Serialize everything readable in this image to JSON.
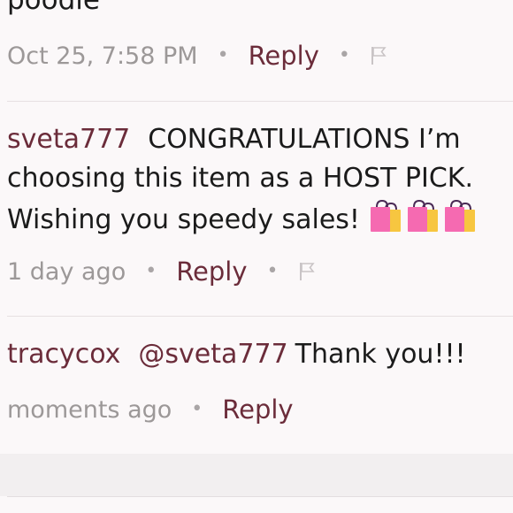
{
  "previous_comment": {
    "text_tail": "poodle",
    "timestamp": "Oct 25, 7:58 PM",
    "reply_label": "Reply",
    "separator": "•"
  },
  "comments": [
    {
      "username": "sveta777",
      "text": "CONGRATULATIONS I’m choosing this item as a HOST PICK. Wishing you speedy sales!",
      "emoji": [
        "shopping-bags-icon",
        "shopping-bags-icon",
        "shopping-bags-icon"
      ],
      "timestamp": "1 day ago",
      "reply_label": "Reply",
      "separator": "•"
    },
    {
      "username": "tracycox",
      "mention": "@sveta777",
      "text": "Thank you!!!",
      "timestamp": "moments ago",
      "reply_label": "Reply",
      "separator": "•"
    }
  ],
  "colors": {
    "username": "#6b2c3a",
    "reply": "#6b2c3a",
    "timestamp": "#9c9898",
    "background": "#fbf8f9"
  }
}
